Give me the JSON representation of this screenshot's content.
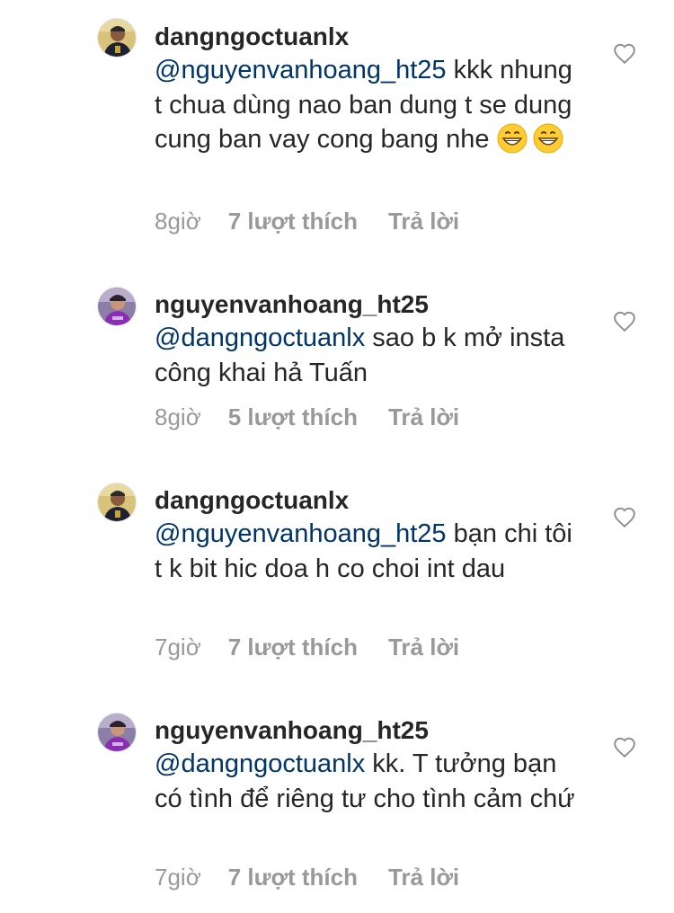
{
  "comments": [
    {
      "username": "dangngoctuanlx",
      "mention": "@nguyenvanhoang_ht25",
      "text": "kkk nhung t chua dùng nao ban dung t se dung cung ban vay cong bang nhe",
      "emojis": [
        "grinning-face-emoji",
        "grinning-face-emoji"
      ],
      "time": "8giờ",
      "likes": "7 lượt thích",
      "reply": "Trả lời",
      "avatar_icon": "avatar-dark-jersey"
    },
    {
      "username": "nguyenvanhoang_ht25",
      "mention": "@dangngoctuanlx",
      "text": "sao b k mở insta công khai hả Tuấn",
      "emojis": [],
      "time": "8giờ",
      "likes": "5 lượt thích",
      "reply": "Trả lời",
      "avatar_icon": "avatar-purple-jersey"
    },
    {
      "username": "dangngoctuanlx",
      "mention": "@nguyenvanhoang_ht25",
      "text": "bạn chi tôi t k bit hic doa h co choi int dau",
      "emojis": [],
      "time": "7giờ",
      "likes": "7 lượt thích",
      "reply": "Trả lời",
      "avatar_icon": "avatar-dark-jersey"
    },
    {
      "username": "nguyenvanhoang_ht25",
      "mention": "@dangngoctuanlx",
      "text": "kk. T tưởng bạn có tình để riêng tư cho tình cảm chứ",
      "emojis": [],
      "time": "7giờ",
      "likes": "7 lượt thích",
      "reply": "Trả lời",
      "avatar_icon": "avatar-purple-jersey"
    }
  ],
  "colors": {
    "text": "#262626",
    "mention": "#003569",
    "meta": "#999999",
    "heart_outline": "#8e8e8e"
  }
}
